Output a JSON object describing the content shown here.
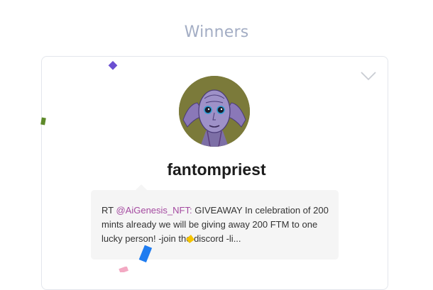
{
  "heading": "Winners",
  "winner": {
    "username": "fantompriest",
    "avatar_icon": "alien-face-avatar",
    "tweet": {
      "prefix": "RT ",
      "mention": "@AiGenesis_NFT:",
      "text": " GIVEAWAY In celebration of 200 mints already we will be giving away 200 FTM to one lucky person! -join the discord -li..."
    }
  },
  "icons": {
    "expand": "chevron-down-icon"
  },
  "colors": {
    "heading": "#a3adc4",
    "mention": "#a44aa0",
    "avatar_bg": "#7b7a3a"
  }
}
